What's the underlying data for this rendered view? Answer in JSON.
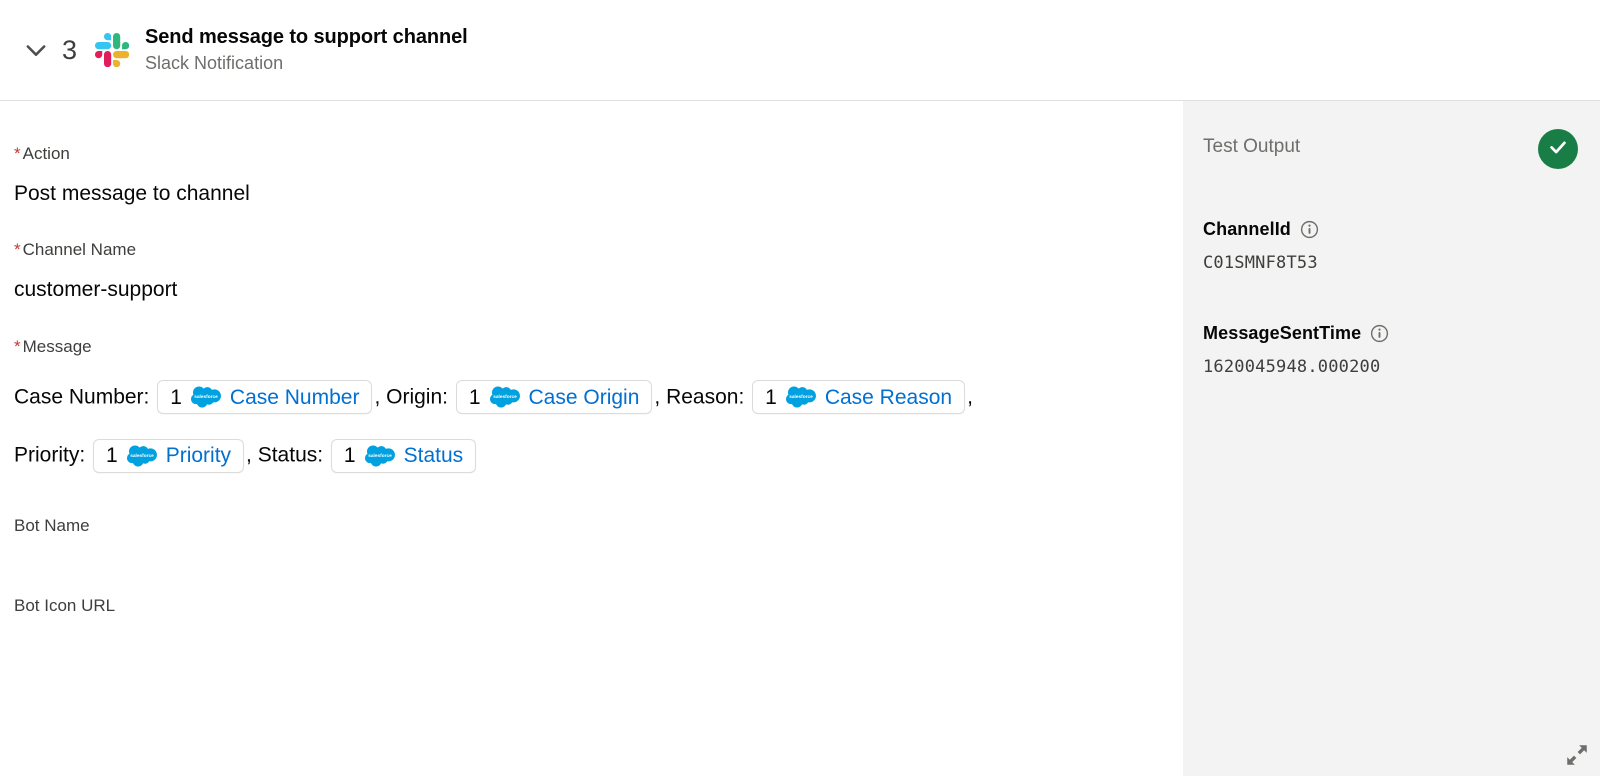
{
  "header": {
    "chevron_icon": "chevron-down-icon",
    "step_number": "3",
    "app_icon": "slack-logo-icon",
    "title": "Send message to support channel",
    "subtitle": "Slack Notification"
  },
  "form": {
    "required_marker": "*",
    "fields": [
      {
        "label": "Action",
        "required": true,
        "value": "Post message to channel"
      },
      {
        "label": "Channel Name",
        "required": true,
        "value": "customer-support"
      },
      {
        "label": "Bot Name",
        "required": false,
        "value": ""
      },
      {
        "label": "Bot Icon URL",
        "required": false,
        "value": ""
      }
    ],
    "message": {
      "label": "Message",
      "required": true,
      "parts": [
        {
          "kind": "text",
          "text": "Case Number:"
        },
        {
          "kind": "token",
          "index": "1",
          "icon": "salesforce-cloud-icon",
          "label": "Case Number"
        },
        {
          "kind": "text",
          "text": ", Origin:"
        },
        {
          "kind": "token",
          "index": "1",
          "icon": "salesforce-cloud-icon",
          "label": "Case Origin"
        },
        {
          "kind": "text",
          "text": ", Reason:"
        },
        {
          "kind": "token",
          "index": "1",
          "icon": "salesforce-cloud-icon",
          "label": "Case Reason"
        },
        {
          "kind": "text",
          "text": ","
        },
        {
          "kind": "break"
        },
        {
          "kind": "text",
          "text": "Priority:"
        },
        {
          "kind": "token",
          "index": "1",
          "icon": "salesforce-cloud-icon",
          "label": "Priority"
        },
        {
          "kind": "text",
          "text": ", Status:"
        },
        {
          "kind": "token",
          "index": "1",
          "icon": "salesforce-cloud-icon",
          "label": "Status"
        }
      ]
    }
  },
  "output": {
    "title": "Test Output",
    "status": "success",
    "status_icon": "check-circle-icon",
    "status_color": "#197e45",
    "fields": [
      {
        "key": "ChannelId",
        "info_icon": "info-circle-icon",
        "value": "C01SMNF8T53"
      },
      {
        "key": "MessageSentTime",
        "info_icon": "info-circle-icon",
        "value": "1620045948.000200"
      }
    ],
    "resize_icon": "resize-expand-icon"
  },
  "colors": {
    "accent_link": "#0070d2",
    "required": "#c23934",
    "panel_bg": "#f3f3f3",
    "success": "#197e45"
  }
}
